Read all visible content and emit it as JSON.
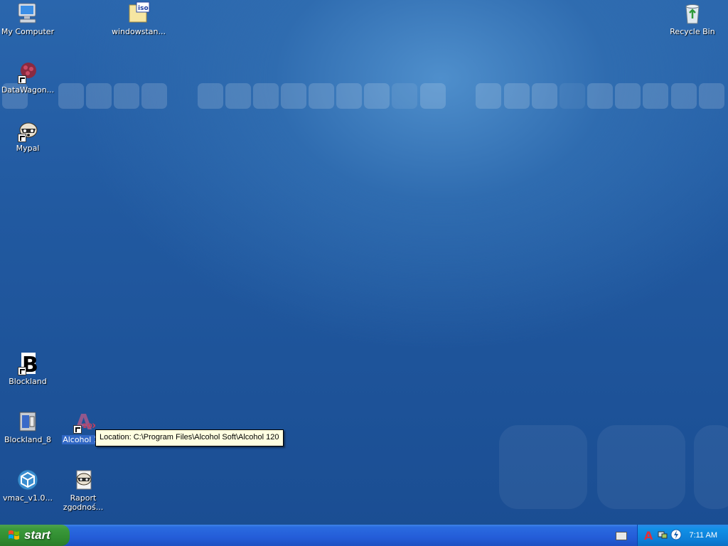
{
  "desktop": {
    "icons": [
      {
        "label": "My Computer",
        "icon": "my-computer-icon"
      },
      {
        "label": "windowstan...",
        "icon": "iso-file-icon"
      },
      {
        "label": "Recycle Bin",
        "icon": "recycle-bin-icon"
      },
      {
        "label": "DataWagon...",
        "icon": "datawagon-icon"
      },
      {
        "label": "Mypal",
        "icon": "mypal-icon"
      },
      {
        "label": "Blockland",
        "icon": "blockland-icon"
      },
      {
        "label": "Blockland_8",
        "icon": "installer-icon"
      },
      {
        "label": "Alcohol 12",
        "icon": "alcohol-icon"
      },
      {
        "label": "vmac_v1.0...",
        "icon": "vmac-icon"
      },
      {
        "label": "Raport zgodnoś...",
        "icon": "mypal-icon"
      }
    ],
    "tooltip": "Location: C:\\Program Files\\Alcohol Soft\\Alcohol 120"
  },
  "taskbar": {
    "start_label": "start",
    "clock": "7:11 AM"
  }
}
